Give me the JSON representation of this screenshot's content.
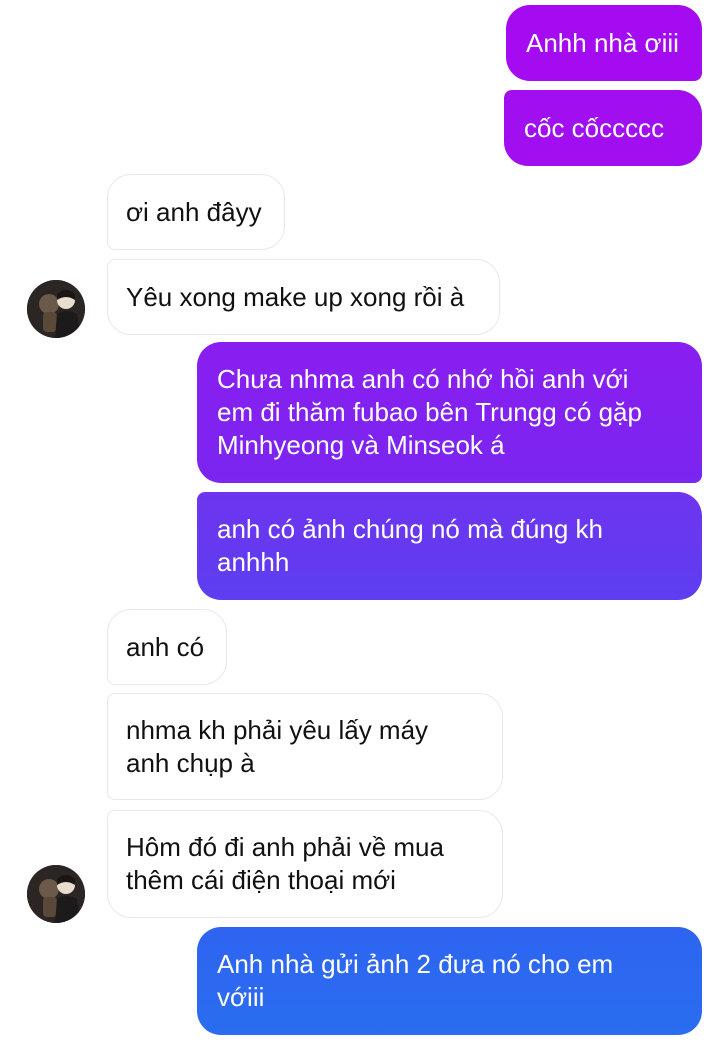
{
  "chat": {
    "messages": [
      {
        "side": "outgoing",
        "text": "Anhh nhà ơiii"
      },
      {
        "side": "outgoing",
        "text": "cốc cốccccc"
      },
      {
        "side": "incoming",
        "text": "ơi anh đâyy"
      },
      {
        "side": "incoming",
        "text": "Yêu xong make up xong rồi à"
      },
      {
        "side": "outgoing",
        "text": "Chưa nhma anh có nhớ hồi anh với\nem đi thăm fubao bên Trungg có gặp\nMinhyeong và Minseok á"
      },
      {
        "side": "outgoing",
        "text": "anh có ảnh chúng nó mà đúng kh\nanhhh"
      },
      {
        "side": "incoming",
        "text": "anh có"
      },
      {
        "side": "incoming",
        "text": "nhma kh phải yêu lấy máy\nanh chụp à"
      },
      {
        "side": "incoming",
        "text": "Hôm đó đi anh phải về mua\nthêm cái điện thoại mới"
      },
      {
        "side": "outgoing",
        "text": "Anh nhà gửi ảnh 2 đưa nó cho em\nvớiii"
      }
    ]
  },
  "colors": {
    "outgoing_top": "#a40af0",
    "outgoing_mid": "#7b2ff0",
    "outgoing_bottom": "#2a6df0",
    "incoming_bg": "#ffffff",
    "incoming_border": "#e8e8e8"
  },
  "icons": {
    "avatar": "contact-avatar"
  }
}
